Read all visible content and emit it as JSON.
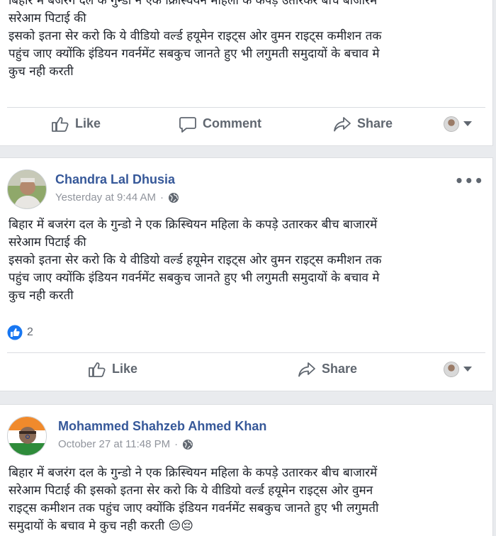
{
  "posts": [
    {
      "text_lines": [
        "बिहार में बजरंग दल के गुन्डो ने एक क्रिस्चियन महिला के कपड़े उतारकर बीच बाजारमें",
        "सरेआम पिटाई की",
        "इसको इतना सेर करो कि ये वीडियो वर्ल्ड हयूमेन राइट्स ओर वुमन राइट्स कमीशन तक",
        "पहुंच जाए क्योंकि इंडियन गवर्नमेंट सबकुच जानते हुए भी लगुमती समुदायों के बचाव मे",
        "कुच नही करती"
      ],
      "actions": {
        "like": "Like",
        "comment": "Comment",
        "share": "Share"
      }
    },
    {
      "author": "Chandra Lal Dhusia",
      "timestamp": "Yesterday at 9:44 AM",
      "text_lines": [
        "बिहार में बजरंग दल के गुन्डो ने एक क्रिस्चियन महिला के कपड़े उतारकर बीच बाजारमें",
        "सरेआम पिटाई की",
        "इसको इतना सेर करो कि ये वीडियो वर्ल्ड हयूमेन राइट्स ओर वुमन राइट्स कमीशन तक",
        "पहुंच जाए क्योंकि इंडियन गवर्नमेंट सबकुच जानते हुए भी लगुमती समुदायों के बचाव मे",
        "कुच नही करती"
      ],
      "reaction_count": "2",
      "actions": {
        "like": "Like",
        "share": "Share"
      },
      "more": "•••"
    },
    {
      "author": "Mohammed Shahzeb Ahmed Khan",
      "timestamp": "October 27 at 11:48 PM",
      "text_lines": [
        "बिहार में बजरंग दल के गुन्डो ने एक क्रिस्चियन महिला के कपड़े उतारकर बीच बाजारमें",
        "सरेआम पिटाई की इसको इतना सेर करो कि ये वीडियो वर्ल्ड हयूमेन राइट्स ओर वुमन",
        "राइट्स कमीशन तक पहुंच जाए क्योंकि इंडियन गवर्नमेंट सबकुच जानते हुए भी लगुमती",
        "समुदायों के बचाव मे कुच नही करती 😔😔"
      ]
    }
  ],
  "colors": {
    "link": "#365899",
    "meta": "#90949c",
    "action": "#606770",
    "like_badge": "#1877f2"
  }
}
